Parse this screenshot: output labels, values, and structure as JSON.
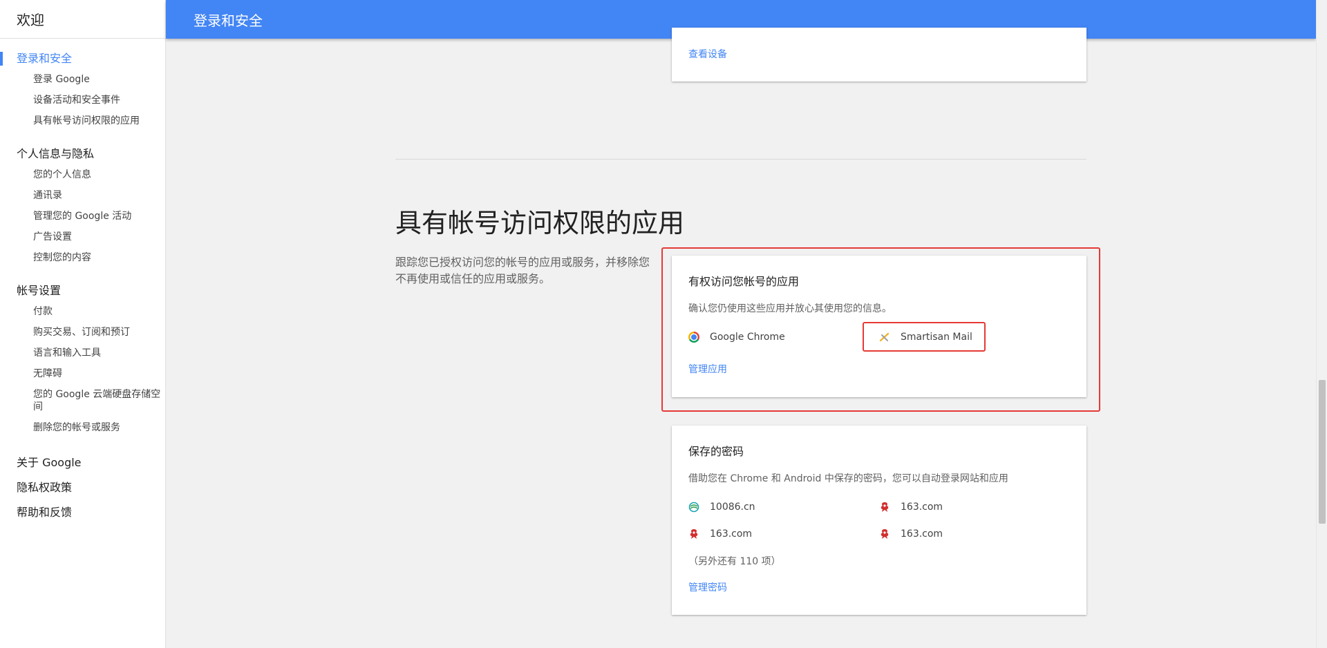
{
  "sidebar": {
    "header": "欢迎",
    "sections": [
      {
        "title": "登录和安全",
        "items": [
          "登录 Google",
          "设备活动和安全事件",
          "具有帐号访问权限的应用"
        ]
      },
      {
        "title": "个人信息与隐私",
        "items": [
          "您的个人信息",
          "通讯录",
          "管理您的 Google 活动",
          "广告设置",
          "控制您的内容"
        ]
      },
      {
        "title": "帐号设置",
        "items": [
          "付款",
          "购买交易、订阅和预订",
          "语言和输入工具",
          "无障碍",
          "您的 Google 云端硬盘存储空间",
          "删除您的帐号或服务"
        ]
      }
    ],
    "footer": [
      "关于 Google",
      "隐私权政策",
      "帮助和反馈"
    ]
  },
  "topbar": {
    "title": "登录和安全"
  },
  "devices_card": {
    "link": "查看设备"
  },
  "section": {
    "title": "具有帐号访问权限的应用",
    "desc": "跟踪您已授权访问您的帐号的应用或服务，并移除您不再使用或信任的应用或服务。"
  },
  "apps_card": {
    "title": "有权访问您帐号的应用",
    "desc": "确认您仍使用这些应用并放心其使用您的信息。",
    "apps": [
      {
        "name": "Google Chrome",
        "icon": "chrome-icon"
      },
      {
        "name": "Smartisan Mail",
        "icon": "smartisan-mail-icon"
      }
    ],
    "link": "管理应用"
  },
  "passwords_card": {
    "title": "保存的密码",
    "desc": "借助您在 Chrome 和 Android 中保存的密码，您可以自动登录网站和应用",
    "sites": [
      {
        "name": "10086.cn",
        "icon": "china-mobile-icon"
      },
      {
        "name": "163.com",
        "icon": "netease-icon"
      },
      {
        "name": "163.com",
        "icon": "netease-icon"
      },
      {
        "name": "163.com",
        "icon": "netease-icon"
      }
    ],
    "more": "（另外还有 110 项）",
    "link": "管理密码"
  },
  "colors": {
    "accent": "#4285f4",
    "highlight": "#e53935"
  }
}
